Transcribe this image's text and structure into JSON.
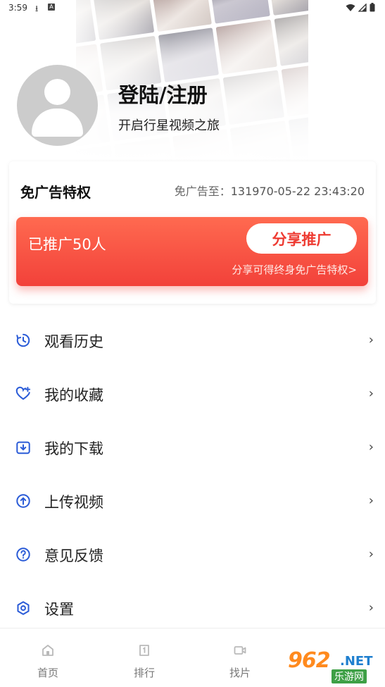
{
  "status": {
    "time": "3:59",
    "icons": [
      "download-icon",
      "a-icon",
      "wifi-icon",
      "signal-icon",
      "battery-icon"
    ]
  },
  "profile": {
    "title": "登陆/注册",
    "subtitle": "开启行星视频之旅"
  },
  "vip": {
    "title": "免广告特权",
    "expire_label": "免广告至：",
    "expire_value": "131970-05-22 23:43:20",
    "promo_count": "已推广50人",
    "share_button": "分享推广",
    "share_tip": "分享可得终身免广告特权>"
  },
  "menu": [
    {
      "label": "观看历史",
      "icon": "history-icon"
    },
    {
      "label": "我的收藏",
      "icon": "heart-plus-icon"
    },
    {
      "label": "我的下载",
      "icon": "download-box-icon"
    },
    {
      "label": "上传视频",
      "icon": "upload-circle-icon"
    },
    {
      "label": "意见反馈",
      "icon": "question-circle-icon"
    },
    {
      "label": "设置",
      "icon": "gear-hexagon-icon"
    }
  ],
  "tabs": [
    {
      "label": "首页",
      "icon": "home-icon"
    },
    {
      "label": "排行",
      "icon": "rank-icon"
    },
    {
      "label": "找片",
      "icon": "video-camera-icon"
    }
  ],
  "watermark": {
    "number": "962",
    "suffix": ".NET",
    "cn": "乐游网"
  },
  "colors": {
    "accent_blue": "#2a5bd7",
    "promo_red": "#f2413a",
    "promo_orange": "#ff6a50"
  }
}
